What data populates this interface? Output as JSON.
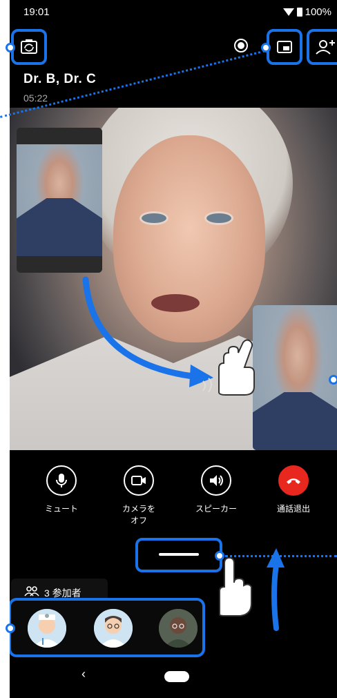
{
  "status_bar": {
    "time": "19:01",
    "battery": "100%"
  },
  "call": {
    "title": "Dr. B, Dr. C",
    "duration": "05:22"
  },
  "controls": [
    {
      "label": "ミュート",
      "icon": "microphone-icon"
    },
    {
      "label": "カメラを\nオフ",
      "icon": "camera-icon"
    },
    {
      "label": "スピーカー",
      "icon": "speaker-icon"
    },
    {
      "label": "通話退出",
      "icon": "hang-up-icon"
    }
  ],
  "participants": {
    "label": "3 参加者"
  },
  "colors": {
    "accent": "#1a73e8",
    "end_call": "#e8271f",
    "background": "#000000"
  }
}
